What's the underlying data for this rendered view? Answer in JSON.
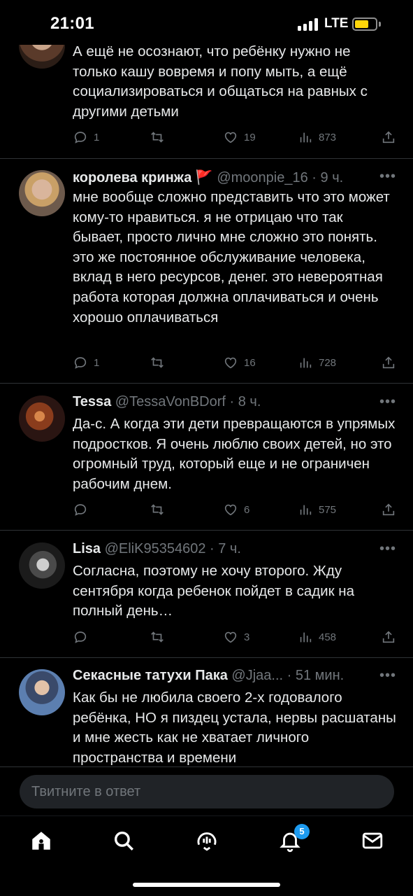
{
  "status_bar": {
    "time": "21:01",
    "network": "LTE"
  },
  "tweets": [
    {
      "name": "",
      "handle": "",
      "time": "",
      "text": "А ещё не осознают, что ребёнку нужно не только кашу вовремя и попу мыть, а ещё социализироваться и общаться на равных с другими детьми",
      "replies": "1",
      "likes": "19",
      "views": "873"
    },
    {
      "name": "королева кринжа 🚩",
      "handle": "@moonpie_16",
      "time": "· 9 ч.",
      "text": "мне вообще сложно представить что это может кому-то нравиться. я не отрицаю что так бывает, просто лично мне сложно это понять. это же постоянное обслуживание человека, вклад в него ресурсов, денег. это невероятная работа которая должна оплачиваться и очень хорошо оплачиваться",
      "replies": "1",
      "likes": "16",
      "views": "728"
    },
    {
      "name": "Tessa",
      "handle": "@TessaVonBDorf",
      "time": "· 8 ч.",
      "text": "Да-с. А когда эти дети превращаются в упрямых подростков. Я очень люблю своих детей, но это огромный труд, который еще и не ограничен рабочим днем.",
      "replies": "",
      "likes": "6",
      "views": "575"
    },
    {
      "name": "Lisa",
      "handle": "@EliK95354602",
      "time": "· 7 ч.",
      "text": "Согласна, поэтому не хочу второго. Жду сентября когда ребенок пойдет в садик на полный день…",
      "replies": "",
      "likes": "3",
      "views": "458"
    },
    {
      "name": "Секасные татухи Пака",
      "handle": "@Jjaa...",
      "time": "· 51 мин.",
      "text": "Как бы не любила своего 2-х годовалого ребёнка, НО я пиздец устала, нервы расшатаны и мне жесть как не хватает личного пространства и времени",
      "replies": "",
      "likes": "",
      "views": ""
    }
  ],
  "reply_bar": {
    "placeholder": "Твитните в ответ"
  },
  "nav": {
    "notifications_badge": "5"
  },
  "icons": [
    "home-icon",
    "search-icon",
    "spaces-icon",
    "notifications-icon",
    "messages-icon",
    "reply-icon",
    "retweet-icon",
    "like-icon",
    "views-icon",
    "share-icon",
    "more-icon"
  ]
}
